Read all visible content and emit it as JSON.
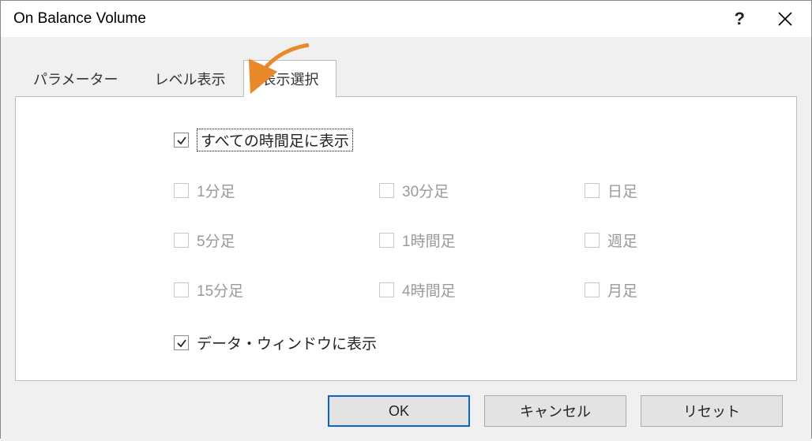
{
  "title": "On Balance Volume",
  "titlebar": {
    "help": "?"
  },
  "tabs": {
    "t0": {
      "label": "パラメーター"
    },
    "t1": {
      "label": "レベル表示"
    },
    "t2": {
      "label": "表示選択"
    }
  },
  "content": {
    "all_timeframes": {
      "label": "すべての時間足に表示",
      "checked": true
    },
    "timeframes": {
      "m1": {
        "label": "1分足"
      },
      "m5": {
        "label": "5分足"
      },
      "m15": {
        "label": "15分足"
      },
      "m30": {
        "label": "30分足"
      },
      "h1": {
        "label": "1時間足"
      },
      "h4": {
        "label": "4時間足"
      },
      "d1": {
        "label": "日足"
      },
      "w1": {
        "label": "週足"
      },
      "mn": {
        "label": "月足"
      }
    },
    "data_window": {
      "label": "データ・ウィンドウに表示",
      "checked": true
    }
  },
  "buttons": {
    "ok": "OK",
    "cancel": "キャンセル",
    "reset": "リセット"
  }
}
